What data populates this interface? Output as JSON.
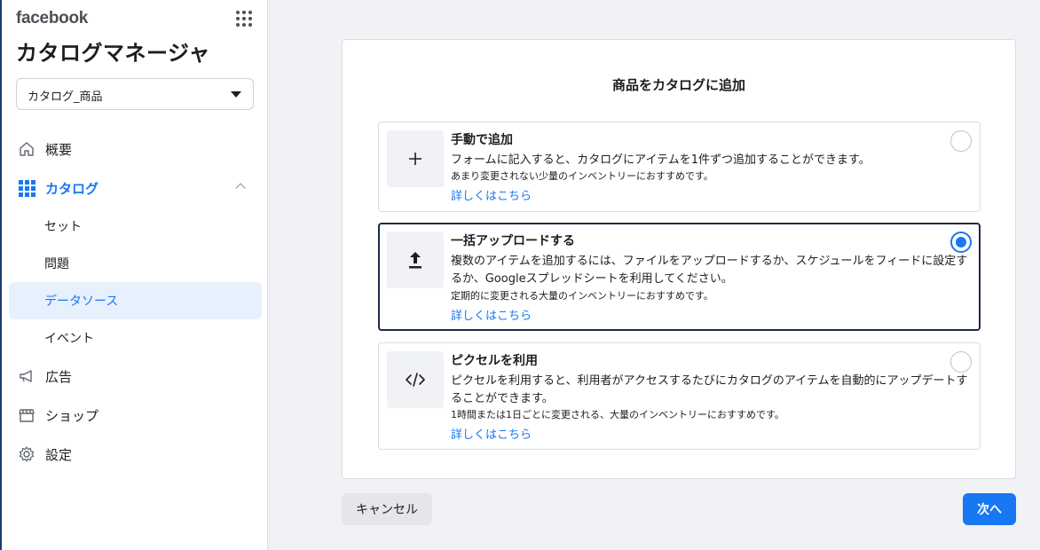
{
  "sidebar": {
    "brand": "facebook",
    "app_title": "カタログマネージャ",
    "catalog_select": {
      "value": "カタログ_商品"
    },
    "nav": {
      "overview": "概要",
      "catalog": "カタログ",
      "sub": [
        "セット",
        "問題",
        "データソース",
        "イベント"
      ],
      "ads": "広告",
      "shop": "ショップ",
      "settings": "設定"
    }
  },
  "main": {
    "title": "商品をカタログに追加",
    "options": [
      {
        "title": "手動で追加",
        "desc": "フォームに記入すると、カタログにアイテムを1件ずつ追加することができます。",
        "note": "あまり変更されない少量のインベントリーにおすすめです。",
        "link": "詳しくはこちら",
        "icon": "plus-icon",
        "selected": false
      },
      {
        "title": "一括アップロードする",
        "desc": "複数のアイテムを追加するには、ファイルをアップロードするか、スケジュールをフィードに設定するか、Googleスプレッドシートを利用してください。",
        "note": "定期的に変更される大量のインベントリーにおすすめです。",
        "link": "詳しくはこちら",
        "icon": "upload-icon",
        "selected": true
      },
      {
        "title": "ピクセルを利用",
        "desc": "ピクセルを利用すると、利用者がアクセスするたびにカタログのアイテムを自動的にアップデートすることができます。",
        "note": "1時間または1日ごとに変更される、大量のインベントリーにおすすめです。",
        "link": "詳しくはこちら",
        "icon": "code-icon",
        "selected": false
      }
    ],
    "cancel_label": "キャンセル",
    "next_label": "次へ"
  },
  "colors": {
    "accent": "#1877f2",
    "selected_bg": "#e7f0fd",
    "background": "#f0f2f5"
  }
}
